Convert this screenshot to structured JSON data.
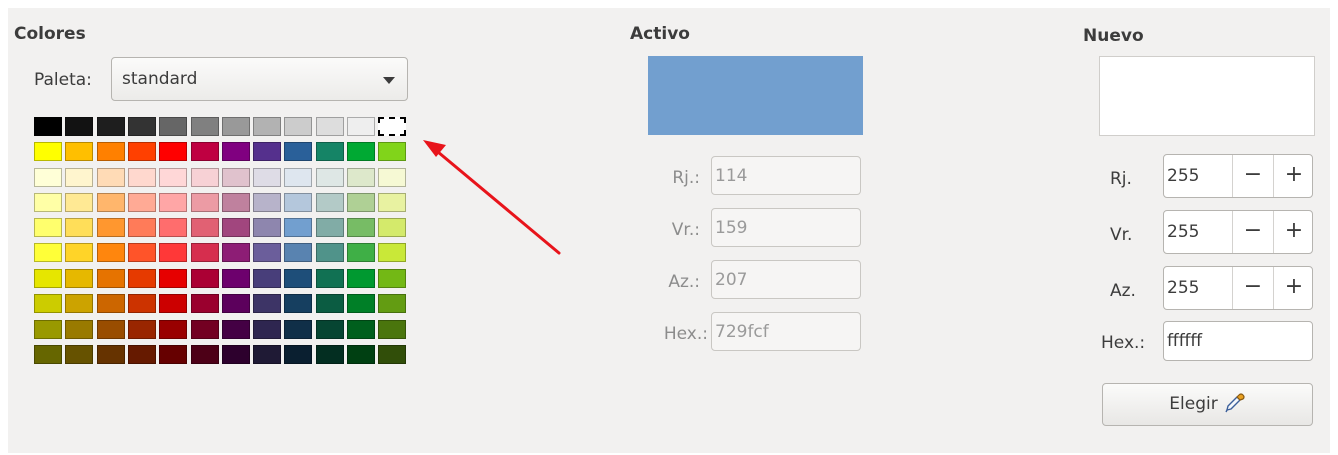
{
  "colores": {
    "heading": "Colores",
    "paleta_label": "Paleta:",
    "paleta_value": "standard",
    "palette_rows": [
      [
        "#000000",
        "#121212",
        "#1e1e1e",
        "#333333",
        "#666666",
        "#808080",
        "#999999",
        "#b2b2b2",
        "#cccccc",
        "#dddddd",
        "#eeeeee",
        "#ffffff"
      ],
      [
        "#ffff00",
        "#ffbf00",
        "#ff8000",
        "#ff4000",
        "#ff0000",
        "#bf0041",
        "#800080",
        "#55308d",
        "#2a6099",
        "#158466",
        "#00a933",
        "#81d41a"
      ],
      [
        "#ffffd7",
        "#fff5ce",
        "#ffdbb6",
        "#ffd8ce",
        "#ffd7d7",
        "#f7d1d5",
        "#e0c2cd",
        "#dedce6",
        "#dee6ef",
        "#dee7e5",
        "#dde8cb",
        "#f6f9d4"
      ],
      [
        "#ffffa6",
        "#ffe994",
        "#ffb66c",
        "#ffaa95",
        "#ffa6a6",
        "#ec9ba4",
        "#bf819e",
        "#b7b3ca",
        "#b4c7dc",
        "#b3cac7",
        "#afd095",
        "#e8f2a1"
      ],
      [
        "#ffff6d",
        "#ffde59",
        "#ff972f",
        "#ff7b59",
        "#ff6d6d",
        "#e16173",
        "#a1467e",
        "#8e86ae",
        "#729fcf",
        "#81aca6",
        "#77bc65",
        "#d4ea6b"
      ],
      [
        "#ffff38",
        "#ffd428",
        "#ff860d",
        "#ff5429",
        "#ff3838",
        "#d62e4e",
        "#8d1d75",
        "#6b5e9b",
        "#5983b0",
        "#50938a",
        "#3faf46",
        "#c9e838"
      ],
      [
        "#e6e600",
        "#e6b800",
        "#e67300",
        "#e63a00",
        "#e60000",
        "#ab0034",
        "#6d006d",
        "#483e7a",
        "#1e4e79",
        "#117153",
        "#009930",
        "#73b815"
      ],
      [
        "#cccc00",
        "#cca300",
        "#cc6600",
        "#cc3300",
        "#cc0000",
        "#9a002e",
        "#5c005c",
        "#3d3466",
        "#163f60",
        "#0b5c42",
        "#007f27",
        "#639c12"
      ],
      [
        "#999900",
        "#997a00",
        "#994d00",
        "#992600",
        "#990000",
        "#730022",
        "#440044",
        "#2e2650",
        "#102f48",
        "#064532",
        "#005f1d",
        "#4a750d"
      ],
      [
        "#666600",
        "#665200",
        "#663300",
        "#661a00",
        "#660000",
        "#4d0017",
        "#2d002d",
        "#1f1a35",
        "#0a1f30",
        "#032e21",
        "#004012",
        "#314e09"
      ]
    ]
  },
  "activo": {
    "heading": "Activo",
    "color": "#729fcf",
    "rj_label": "Rj.:",
    "rj_value": "114",
    "vr_label": "Vr.:",
    "vr_value": "159",
    "az_label": "Az.:",
    "az_value": "207",
    "hex_label": "Hex.:",
    "hex_value": "729fcf"
  },
  "nuevo": {
    "heading": "Nuevo",
    "color": "#ffffff",
    "rj_label": "Rj.",
    "rj_value": "255",
    "vr_label": "Vr.",
    "vr_value": "255",
    "az_label": "Az.",
    "az_value": "255",
    "hex_label": "Hex.:",
    "hex_value": "ffffff",
    "minus": "−",
    "plus": "+",
    "elegir_label": "Elegir"
  },
  "icons": {
    "eyedropper": "eyedropper-icon",
    "annotation": "red-arrow"
  },
  "colors": {
    "annotation_arrow": "#e8141b"
  }
}
